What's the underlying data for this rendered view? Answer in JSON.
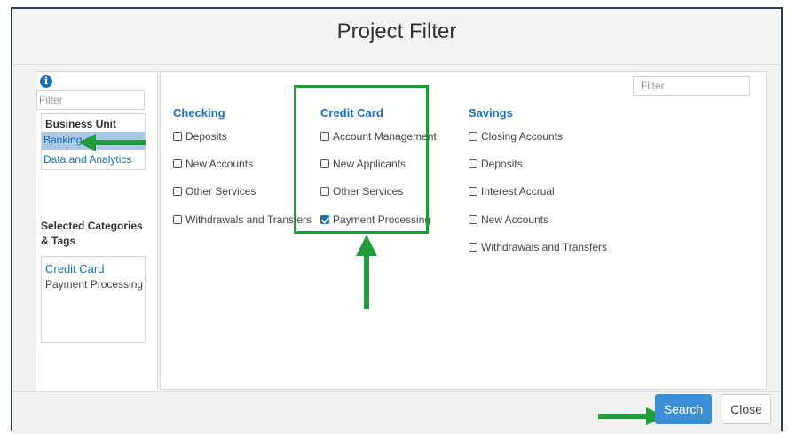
{
  "dialog": {
    "title": "Project Filter"
  },
  "left": {
    "filter_placeholder": "Filter",
    "business_unit_title": "Business Unit",
    "business_units": [
      "Banking",
      "Data and Analytics"
    ],
    "selected_unit": "Banking",
    "selected_title": "Selected Categories & Tags",
    "selected_category": "Credit Card",
    "selected_tag": "Payment Processing"
  },
  "main": {
    "filter_placeholder": "Filter",
    "columns": [
      {
        "title": "Checking",
        "options": [
          {
            "label": "Deposits",
            "checked": false
          },
          {
            "label": "New Accounts",
            "checked": false
          },
          {
            "label": "Other Services",
            "checked": false
          },
          {
            "label": "Withdrawals and Transfers",
            "checked": false
          }
        ]
      },
      {
        "title": "Credit Card",
        "options": [
          {
            "label": "Account Management",
            "checked": false
          },
          {
            "label": "New Applicants",
            "checked": false
          },
          {
            "label": "Other Services",
            "checked": false
          },
          {
            "label": "Payment Processing",
            "checked": true
          }
        ]
      },
      {
        "title": "Savings",
        "options": [
          {
            "label": "Closing Accounts",
            "checked": false
          },
          {
            "label": "Deposits",
            "checked": false
          },
          {
            "label": "Interest Accrual",
            "checked": false
          },
          {
            "label": "New Accounts",
            "checked": false
          },
          {
            "label": "Withdrawals and Transfers",
            "checked": false
          }
        ]
      }
    ]
  },
  "footer": {
    "search_label": "Search",
    "close_label": "Close"
  },
  "colors": {
    "accent": "#1a6fb8",
    "highlight": "#1f9b3a",
    "selected_bg": "#a9c8e8"
  },
  "icons": {
    "info": "info-icon"
  }
}
